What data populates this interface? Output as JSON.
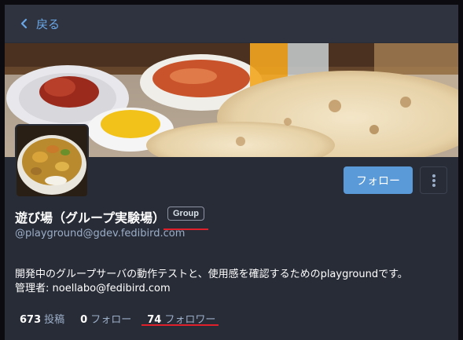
{
  "nav": {
    "back_label": "戻る"
  },
  "profile": {
    "display_name": "遊び場（グループ実験場）",
    "badge": "Group",
    "acct": "@playground@gdev.fedibird.com",
    "note_line1": "開発中のグループサーバの動作テストと、使用感を確認するためのplaygroundです。",
    "note_line2": "管理者: noellabo@fedibird.com"
  },
  "actions": {
    "follow_label": "フォロー"
  },
  "stats": [
    {
      "value": "673",
      "label": "投稿"
    },
    {
      "value": "0",
      "label": "フォロー"
    },
    {
      "value": "74",
      "label": "フォロワー"
    }
  ],
  "colors": {
    "accent": "#5b9ad9",
    "background": "#282c37",
    "annotation": "#e0202a"
  },
  "icons": {
    "back": "chevron-left-icon",
    "more": "vertical-ellipsis-icon"
  }
}
